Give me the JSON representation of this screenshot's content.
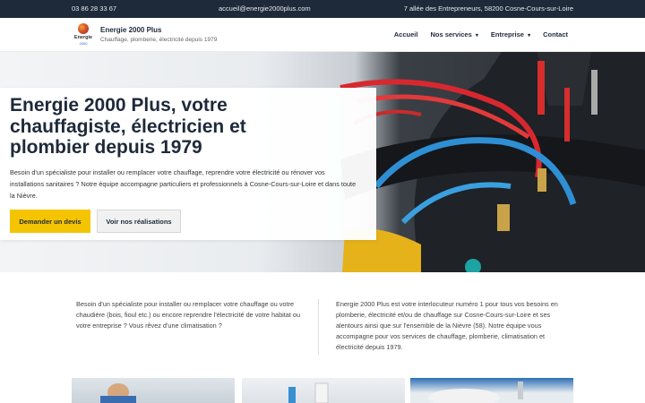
{
  "topbar": {
    "phone": "03 86 28 33 67",
    "email": "accueil@energie2000plus.com",
    "address": "7 allée des Entrepreneurs, 58200 Cosne-Cours-sur-Loire"
  },
  "header": {
    "logo_text": "Energie",
    "logo_subtext": "2000",
    "brand_name": "Energie 2000 Plus",
    "tagline": "Chauffage, plomberie, électricité depuis 1979"
  },
  "nav": {
    "items": [
      {
        "label": "Accueil",
        "dropdown": false
      },
      {
        "label": "Nos services",
        "dropdown": true
      },
      {
        "label": "Entreprise",
        "dropdown": true
      },
      {
        "label": "Contact",
        "dropdown": false
      }
    ],
    "caret": "▾"
  },
  "hero": {
    "title": "Energie 2000 Plus, votre chauffagiste, électricien et plombier depuis 1979",
    "text": "Besoin d'un spécialiste pour installer ou remplacer votre chauffage, reprendre votre électricité ou rénover vos installations sanitaires ? Notre équipe accompagne particuliers et professionnels à Cosne-Cours-sur-Loire et dans toute la Nièvre.",
    "primary_button": "Demander un devis",
    "secondary_button": "Voir nos réalisations"
  },
  "intro": {
    "left_text": "Besoin d'un spécialiste pour installer ou remplacer votre chauffage ou votre chaudière (bois, fioul etc.) ou encore reprendre l'électricité de votre habitat ou votre entreprise ? Vous rêvez d'une climatisation ?",
    "right_text": "Energie 2000 Plus est votre interlocuteur numéro 1 pour tous vos besoins en plomberie, électricité et/ou de chauffage sur Cosne-Cours-sur-Loire et ses alentours ainsi que sur l'ensemble de la Nièvre (58). Notre équipe vous accompagne pour vos services de chauffage, plomberie, climatisation et électricité depuis 1979."
  },
  "colors": {
    "topbar_bg": "#1e2a3a",
    "primary_accent": "#f5c400",
    "heading": "#1e2a3a"
  }
}
